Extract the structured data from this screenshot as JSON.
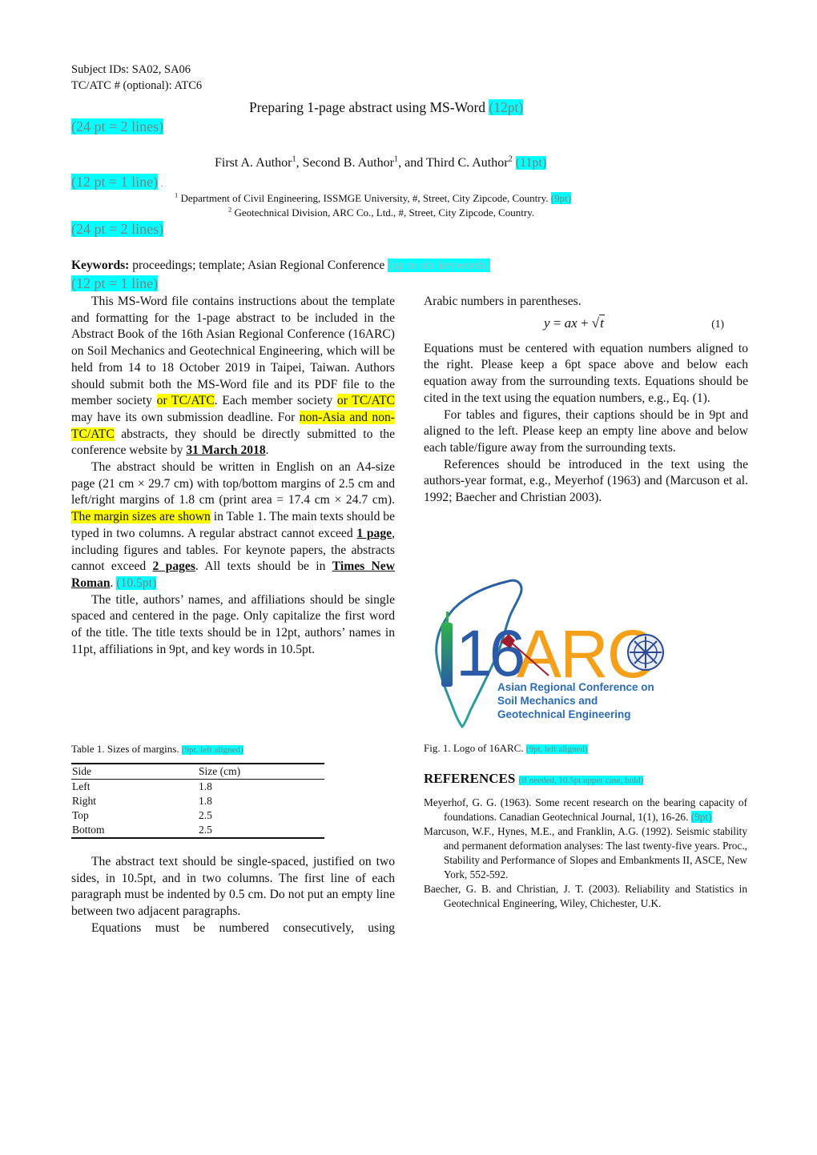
{
  "header": {
    "subject_ids": "Subject IDs: SA02, SA06",
    "tc_atc": "TC/ATC # (optional): ATC6"
  },
  "title": {
    "text": "Preparing 1-page abstract using MS-Word",
    "note": "(12pt)",
    "spacing_note": "(24 pt = 2 lines)"
  },
  "authors": {
    "a1": "First A. Author",
    "a1_sup": "1",
    "a2": ", Second B. Author",
    "a2_sup": "1",
    "a3": ", and Third C. Author",
    "a3_sup": "2",
    "note": "(11pt)",
    "spacing_note": "(12 pt = 1 line)",
    "spacing_dot": " ."
  },
  "affiliations": {
    "aff1_sup": "1",
    "aff1": " Department of Civil Engineering, ISSMGE University, #, Street, City Zipcode, Country.",
    "aff1_note": "(9pt)",
    "aff2_sup": "2",
    "aff2": " Geotechnical Division, ARC Co., Ltd., #, Street, City Zipcode, Country.",
    "spacing_note": "(24 pt = 2 lines)"
  },
  "keywords": {
    "label": "Keywords:",
    "text": " proceedings; template; Asian Regional Conference ",
    "note": "(up to six keywords)",
    "spacing_note": "(12 pt = 1 line)"
  },
  "left_column": {
    "p1": {
      "t1": "This MS-Word file contains instructions about the template and formatting for the 1-page abstract to be included in the Abstract Book of the 16th Asian Regional Conference (16ARC) on Soil Mechanics and Geotechnical Engineering, which will be held from 14 to 18 October 2019 in Taipei, Taiwan. Authors should submit both the MS-Word file and its PDF file to the member society ",
      "h1": "or TC/ATC",
      "t2": ". Each member society ",
      "h2": "or TC/ATC",
      "t3": " may have its own submission deadline. For ",
      "h3": "non-Asia and non-TC/ATC",
      "t4": " abstracts, they should be directly submitted to the conference website by ",
      "b1": "31 March 2018",
      "t5": "."
    },
    "p2": {
      "t1": "The abstract should be written in English on an A4-size page (21 cm × 29.7 cm) with top/bottom margins of 2.5 cm and left/right margins of 1.8 cm (print area = 17.4 cm × 24.7 cm). ",
      "h1": "The margin sizes are shown",
      "t2": " in Table 1. The main texts should be typed in two columns. A regular abstract cannot exceed ",
      "b1": "1 page",
      "t3": ", including figures and tables. For keynote papers, the abstracts cannot exceed ",
      "b2": "2 pages",
      "t4": ". All texts should be in ",
      "b3": "Times New Roman",
      "t5": ". ",
      "note": "(10.5pt)"
    },
    "p3": "The title, authors’ names, and affiliations should be single spaced and centered in the page. Only capitalize the first word of the title. The title texts should be in 12pt, authors’ names in 11pt, affiliations in 9pt, and key words in 10.5pt.",
    "table_caption": "Table 1. Sizes of margins. ",
    "table_caption_note": "(9pt, left aligned)",
    "table": {
      "headers": [
        "Side",
        "Size (cm)"
      ],
      "rows": [
        [
          "Left",
          "1.8"
        ],
        [
          "Right",
          "1.8"
        ],
        [
          "Top",
          "2.5"
        ],
        [
          "Bottom",
          "2.5"
        ]
      ]
    },
    "p4": "The abstract text should be single-spaced, justified on two sides, in 10.5pt, and in two columns. The first line of each paragraph must be indented by 0.5 cm. Do not put an empty line between two adjacent paragraphs.",
    "p5": "Equations must be numbered consecutively, using"
  },
  "right_column": {
    "p5_cont": "Arabic numbers in parentheses.",
    "equation": {
      "lhs": "y",
      "eq": " = ",
      "ax": "ax",
      "plus": " + ",
      "sqrt_arg": "t",
      "number": "(1)"
    },
    "p6": "Equations must be centered with equation numbers aligned to the right. Please keep a 6pt space above and below each equation away from the surrounding texts. Equations should be cited in the text using the equation numbers, e.g., Eq. (1).",
    "p7": "For tables and figures, their captions should be in 9pt and aligned to the left. Please keep an empty line above and below each table/figure away from the surrounding texts.",
    "p8": "References should be introduced in the text using the authors-year format, e.g., Meyerhof (1963) and (Marcuson et al. 1992; Baecher and Christian 2003).",
    "logo": {
      "number": "16",
      "acronym": "ARC",
      "line1": "Asian Regional Conference on",
      "line2": "Soil Mechanics and",
      "line3": "Geotechnical Engineering",
      "colors": {
        "orange": "#f5a01a",
        "blue": "#2a5aa8",
        "green": "#2bb24c",
        "text_blue": "#2b6cb8",
        "red": "#a01c2c"
      }
    },
    "fig_caption": "Fig. 1. Logo of 16ARC. ",
    "fig_caption_note": "(9pt, left aligned)",
    "references_heading": "REFERENCES",
    "references_note": "(if needed, 10.5pt upper case, bold)",
    "references": [
      {
        "text": "Meyerhof, G. G. (1963). Some recent research on the bearing capacity of foundations. Canadian Geotechnical Journal, 1(1), 16-26. ",
        "note": "(9pt)"
      },
      {
        "text": "Marcuson, W.F., Hynes, M.E., and Franklin, A.G. (1992). Seismic stability and permanent deformation analyses: The last twenty-five years. Proc., Stability and Performance of Slopes and Embankments II, ASCE, New York, 552-592.",
        "note": ""
      },
      {
        "text": "Baecher, G. B. and Christian, J. T. (2003). Reliability and Statistics in Geotechnical Engineering, Wiley, Chichester, U.K.",
        "note": ""
      }
    ]
  },
  "colors": {
    "note_highlight": "#00ffff",
    "note_text": "#808080",
    "text_highlight": "#ffff00"
  }
}
